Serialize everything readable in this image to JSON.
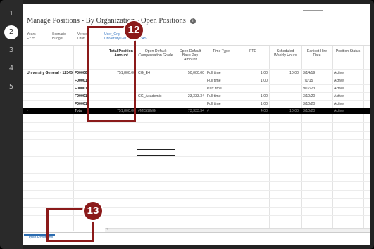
{
  "steps": [
    "1",
    "2",
    "3",
    "4",
    "5"
  ],
  "page": {
    "title": "Manage Positions - By Organization - Open Positions",
    "info_icon": "info-icon"
  },
  "pov": [
    {
      "label": "Years",
      "value": "FY25"
    },
    {
      "label": "Scenario",
      "value": "Budget"
    },
    {
      "label": "Version",
      "value": "Draft"
    },
    {
      "label": "User_Org",
      "value": "University General - 12345"
    }
  ],
  "columns": [
    "Total Position Amount",
    "Open Default Compensation Grade",
    "Open Default Base Pay Amount",
    "Time Type",
    "FTE",
    "Scheduled Weekly Hours",
    "Earliest Hire Date",
    "Position Status"
  ],
  "org_label": "University General - 12345",
  "rows": [
    {
      "position": "F000005",
      "total": "751,800.00",
      "grade": "CG_E4",
      "base_pay": "50,000.00",
      "time_type": "Full time",
      "fte": "1.00",
      "hours": "10.00",
      "hire_date": "3/14/19",
      "status": "Active"
    },
    {
      "position": "F000012",
      "total": "",
      "grade": "",
      "base_pay": "",
      "time_type": "Full time",
      "fte": "1.00",
      "hours": "",
      "hire_date": "7/1/15",
      "status": "Active"
    },
    {
      "position": "F000016",
      "total": "",
      "grade": "",
      "base_pay": "",
      "time_type": "Part time",
      "fte": "",
      "hours": "",
      "hire_date": "9/17/23",
      "status": "Active"
    },
    {
      "position": "F000018",
      "total": "",
      "grade": "CG_Academic",
      "base_pay": "23,333.34",
      "time_type": "Full time",
      "fte": "1.00",
      "hours": "",
      "hire_date": "3/10/20",
      "status": "Active"
    },
    {
      "position": "F000019",
      "total": "",
      "grade": "",
      "base_pay": "",
      "time_type": "Full time",
      "fte": "1.00",
      "hours": "",
      "hire_date": "3/10/20",
      "status": "Active"
    }
  ],
  "total_row": {
    "marker": "-",
    "label": "Total",
    "total": "751,800.00",
    "grade": "#MISSING",
    "base_pay": "73,333.34",
    "time_type": "#",
    "fte": "4.00",
    "hours": "10.00",
    "hire_date": "3/10/20",
    "status": "Active"
  },
  "tabs": [
    "Open Positions"
  ],
  "callouts": [
    "12",
    "13"
  ],
  "colors": {
    "callout": "#8b1a1a",
    "tab": "#2b6cb0"
  }
}
